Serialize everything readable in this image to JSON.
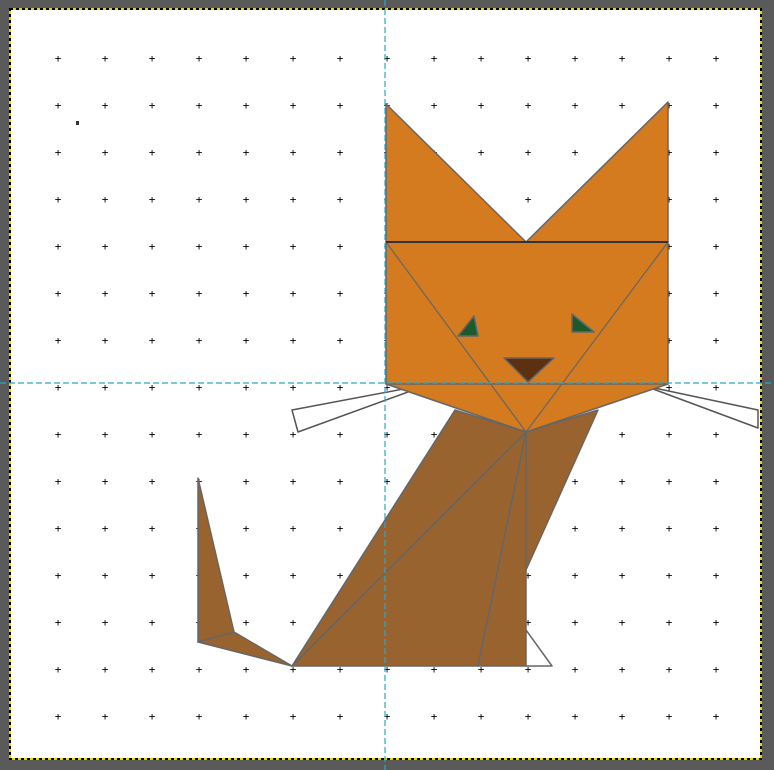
{
  "canvas": {
    "background": "#ffffff",
    "frame_color": "#5a5a5a",
    "boundary_color": "#e6d800",
    "grid_marker": "+",
    "grid_color": "#000000",
    "guide_color": "#2aa8c8"
  },
  "figure": {
    "subject": "geometric tangram-style cat",
    "ear_color": "#d47a1f",
    "face_color": "#d47a1f",
    "body_color": "#98632e",
    "eye_color": "#1b5a2a",
    "nose_color": "#5c3010",
    "whisker_color": "#ffffff",
    "edge_color": "#666666"
  }
}
